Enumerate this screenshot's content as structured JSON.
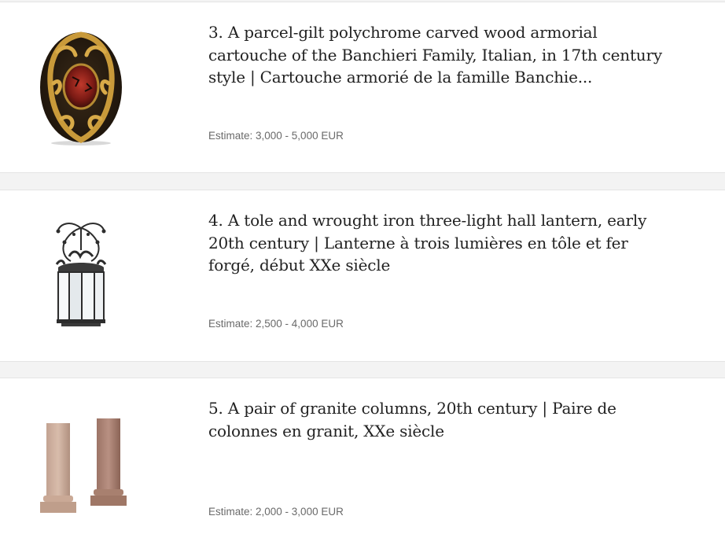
{
  "lots": [
    {
      "title": "3. A parcel-gilt polychrome carved wood armorial cartouche of the Banchieri Family, Italian, in 17th century style | Cartouche armorié de la famille Banchie...",
      "estimate": "Estimate: 3,000 - 5,000 EUR",
      "image_icon": "cartouche-image"
    },
    {
      "title": "4. A tole and wrought iron three-light hall lantern, early 20th century | Lanterne à trois lumières en tôle et fer forgé, début XXe siècle",
      "estimate": "Estimate: 2,500 - 4,000 EUR",
      "image_icon": "lantern-image"
    },
    {
      "title": "5. A pair of granite columns, 20th century | Paire de colonnes en granit, XXe siècle",
      "estimate": "Estimate: 2,000 - 3,000 EUR",
      "image_icon": "columns-image"
    }
  ],
  "colors": {
    "background": "#f3f3f3",
    "card": "#ffffff",
    "title": "#222222",
    "estimate": "#6a6a6a"
  }
}
